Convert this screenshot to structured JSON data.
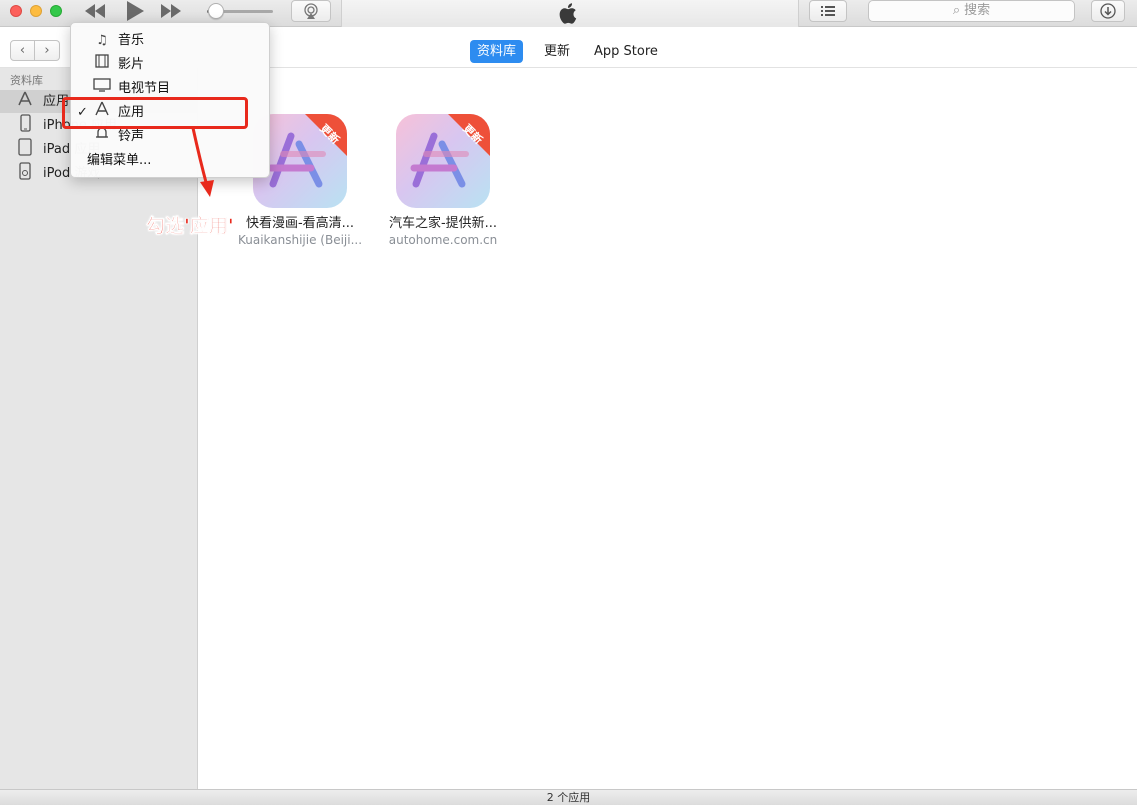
{
  "window": {
    "traffic_lights": [
      "close",
      "minimize",
      "zoom"
    ]
  },
  "toolbar": {
    "search_placeholder": "搜索",
    "icons": {
      "rewind": "rewind-icon",
      "play": "play-icon",
      "forward": "fast-forward-icon",
      "airplay": "airplay-icon",
      "apple": "apple-logo-icon",
      "list": "list-icon",
      "download": "download-icon"
    },
    "volume_level": 0.1
  },
  "navbar": {
    "back": "‹",
    "forward": "›",
    "tabs": [
      {
        "label": "资料库",
        "active": true
      },
      {
        "label": "更新",
        "active": false
      },
      {
        "label": "App Store",
        "active": false
      }
    ]
  },
  "sidebar": {
    "header": "资料库",
    "items": [
      {
        "label": "应用",
        "icon": "apps-icon",
        "selected": true
      },
      {
        "label": "iPhone 应用",
        "icon": "iphone-icon",
        "selected": false
      },
      {
        "label": "iPad 应用",
        "icon": "ipad-icon",
        "selected": false
      },
      {
        "label": "iPod 游戏",
        "icon": "ipod-icon",
        "selected": false
      }
    ]
  },
  "menu": {
    "items": [
      {
        "label": "音乐",
        "icon": "music-note-icon",
        "checked": false
      },
      {
        "label": "影片",
        "icon": "film-icon",
        "checked": false
      },
      {
        "label": "电视节目",
        "icon": "tv-icon",
        "checked": false
      },
      {
        "label": "应用",
        "icon": "app-store-icon",
        "checked": true
      },
      {
        "label": "铃声",
        "icon": "bell-icon",
        "checked": false
      }
    ],
    "edit_label": "编辑菜单..."
  },
  "apps": [
    {
      "name": "快看漫画-看高清...",
      "developer": "Kuaikanshijie (Beiji...",
      "badge": "更新"
    },
    {
      "name": "汽车之家-提供新...",
      "developer": "autohome.com.cn",
      "badge": "更新"
    }
  ],
  "annotation": {
    "text": "勾选'应用'"
  },
  "status": {
    "text": "2 个应用"
  },
  "colors": {
    "accent": "#2d8cf0",
    "annotation_red": "#e8291c",
    "badge_red": "#ee5039"
  }
}
